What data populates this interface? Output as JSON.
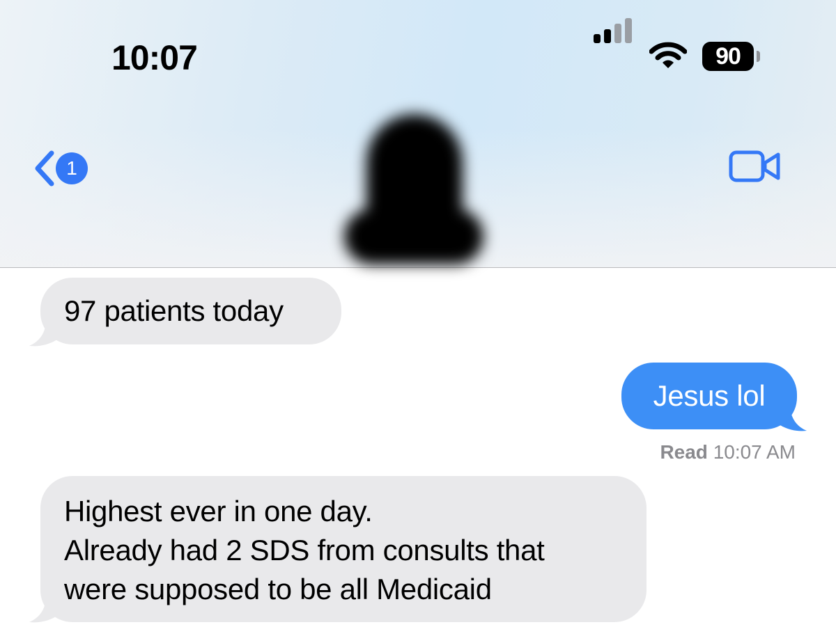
{
  "status_bar": {
    "time": "10:07",
    "battery_level": "90",
    "icons": [
      "signal-bars-icon",
      "wifi-icon",
      "battery-icon"
    ]
  },
  "nav": {
    "back_icon": "chevron-left-icon",
    "back_badge": "1",
    "video_icon": "video-camera-icon",
    "contact_avatar": "redacted"
  },
  "messages": [
    {
      "direction": "incoming",
      "text": "97 patients today"
    },
    {
      "direction": "outgoing",
      "text": "Jesus lol"
    },
    {
      "direction": "incoming",
      "lines": [
        "Highest ever in one day.",
        "Already had 2 SDS from consults that",
        "were supposed to be all Medicaid"
      ]
    }
  ],
  "receipt": {
    "status": "Read",
    "time": "10:07 AM"
  },
  "colors": {
    "accent": "#3478f6",
    "outgoing_bubble": "#3d8ff6",
    "incoming_bubble": "#e9e9eb",
    "receipt_text": "#8a8a8e"
  }
}
